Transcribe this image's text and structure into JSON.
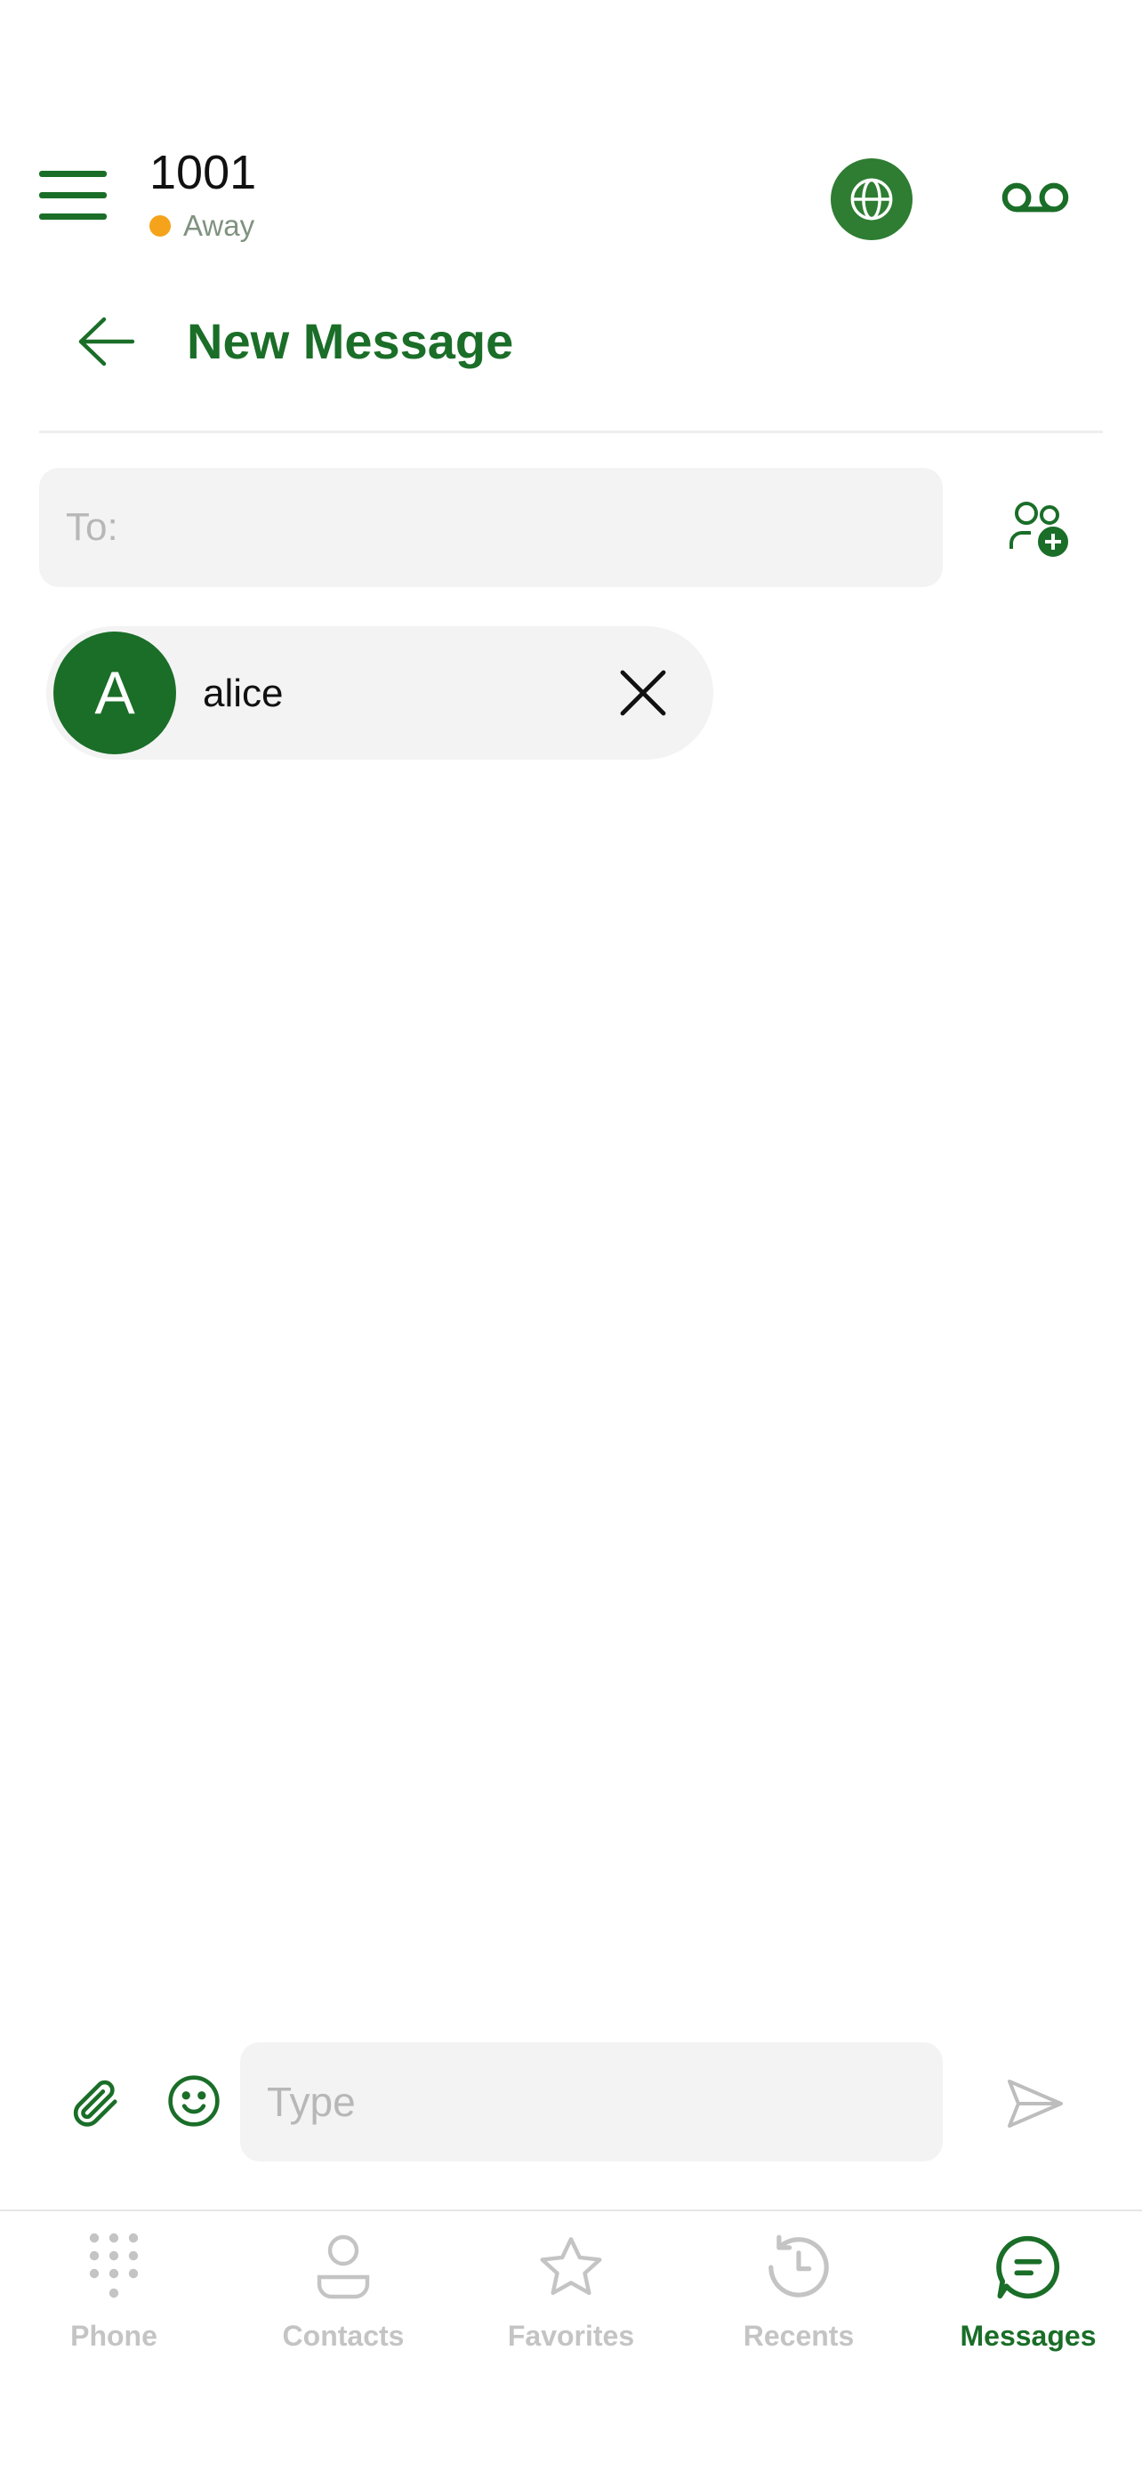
{
  "header": {
    "extension": "1001",
    "status": "Away",
    "status_color": "#f5a31a",
    "menu_icon": "hamburger-menu-icon",
    "globe_icon": "globe-icon",
    "voicemail_icon": "voicemail-icon"
  },
  "title_bar": {
    "back_icon": "arrow-left-icon",
    "title": "New Message"
  },
  "recipient": {
    "to_placeholder": "To:",
    "to_value": "",
    "add_contact_icon": "add-contact-icon",
    "chips": [
      {
        "initial": "A",
        "name": "alice",
        "remove_icon": "close-icon"
      }
    ]
  },
  "composer": {
    "attach_icon": "paperclip-icon",
    "emoji_icon": "smiley-icon",
    "placeholder": "Type",
    "send_icon": "send-icon"
  },
  "bottom_nav": {
    "items": [
      {
        "label": "Phone",
        "icon": "dialpad-icon",
        "active": false
      },
      {
        "label": "Contacts",
        "icon": "person-icon",
        "active": false
      },
      {
        "label": "Favorites",
        "icon": "star-icon",
        "active": false
      },
      {
        "label": "Recents",
        "icon": "history-icon",
        "active": false
      },
      {
        "label": "Messages",
        "icon": "chat-bubble-icon",
        "active": true
      }
    ]
  },
  "colors": {
    "brand_green": "#1a6e28",
    "globe_bg": "#2e7d32",
    "field_bg": "#f3f3f3",
    "inactive_nav": "#c4c4c4"
  }
}
